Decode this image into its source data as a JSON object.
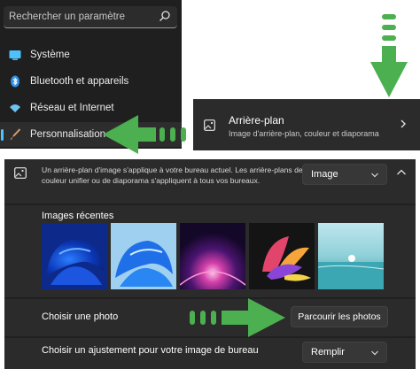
{
  "search": {
    "placeholder": "Rechercher un paramètre",
    "icon": "search-icon"
  },
  "sidebar": {
    "items": [
      {
        "label": "Système",
        "icon": "monitor-icon",
        "color": "#4cc2ff"
      },
      {
        "label": "Bluetooth et appareils",
        "icon": "bluetooth-icon",
        "color": "#2f8fe6"
      },
      {
        "label": "Réseau et Internet",
        "icon": "wifi-icon",
        "color": "#6fc3f0"
      },
      {
        "label": "Personnalisation",
        "icon": "paintbrush-icon",
        "color": "#d9a06a",
        "active": true
      }
    ]
  },
  "background_card": {
    "title": "Arrière-plan",
    "subtitle": "Image d'arrière-plan, couleur et diaporama",
    "icon": "image-icon"
  },
  "panel": {
    "description": "Un arrière-plan d'image s'applique à votre bureau actuel. Les arrière-plans de couleur unifier ou de diaporama s'appliquent à tous vos bureaux.",
    "background_type": "Image",
    "recent_images_label": "Images récentes",
    "recent_images": [
      "blue-bloom",
      "blue-bloom-light",
      "purple-glow",
      "flower-colorful",
      "lake-sunrise"
    ],
    "choose_photo_label": "Choisir une photo",
    "browse_button": "Parcourir les photos",
    "fit_label": "Choisir un ajustement pour votre image de bureau",
    "fit_value": "Remplir"
  },
  "colors": {
    "accent": "#4cc2ff",
    "annotation_green": "#4caf50",
    "panel_bg": "#202020",
    "card_bg": "#2b2b2b"
  }
}
